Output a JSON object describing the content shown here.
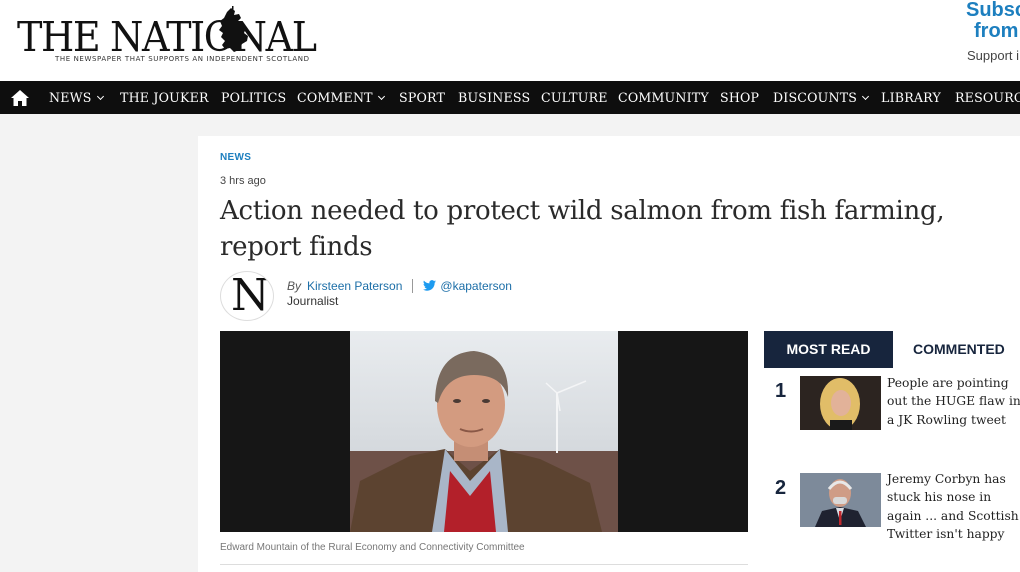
{
  "header": {
    "logo_text": "THE NATIONAL",
    "logo_tagline": "THE NEWSPAPER THAT SUPPORTS AN INDEPENDENT SCOTLAND",
    "subscribe_line1": "Subsc",
    "subscribe_line2": "from",
    "subscribe_line3": "Support i"
  },
  "nav": {
    "home_icon": "home-icon",
    "items": [
      {
        "label": "NEWS",
        "dropdown": true
      },
      {
        "label": "THE JOUKER",
        "dropdown": false
      },
      {
        "label": "POLITICS",
        "dropdown": false
      },
      {
        "label": "COMMENT",
        "dropdown": true
      },
      {
        "label": "SPORT",
        "dropdown": false
      },
      {
        "label": "BUSINESS",
        "dropdown": false
      },
      {
        "label": "CULTURE",
        "dropdown": false
      },
      {
        "label": "COMMUNITY",
        "dropdown": false
      },
      {
        "label": "SHOP",
        "dropdown": false
      },
      {
        "label": "DISCOUNTS",
        "dropdown": true
      },
      {
        "label": "LIBRARY",
        "dropdown": false
      },
      {
        "label": "RESOURCES",
        "dropdown": false
      }
    ]
  },
  "article": {
    "kicker": "NEWS",
    "time": "3 hrs ago",
    "headline": "Action needed to protect wild salmon from fish farming, report finds",
    "avatar_letter": "N",
    "by": "By",
    "author": "Kirsteen Paterson",
    "twitter_handle": "@kapaterson",
    "role": "Journalist",
    "caption": "Edward Mountain of the Rural Economy and Connectivity Committee"
  },
  "most_read": {
    "tab_most": "MOST READ",
    "tab_commented": "COMMENTED",
    "items": [
      {
        "rank": "1",
        "text": "People are pointing out the HUGE flaw in a JK Rowling tweet"
      },
      {
        "rank": "2",
        "text": "Jeremy Corbyn has stuck his nose in again ... and Scottish Twitter isn't happy"
      }
    ]
  },
  "colors": {
    "nav_bg": "#0e0e0e",
    "accent_blue": "#1d7fbf",
    "most_read_tab": "#17253d",
    "page_bg": "#f3f3f3"
  }
}
